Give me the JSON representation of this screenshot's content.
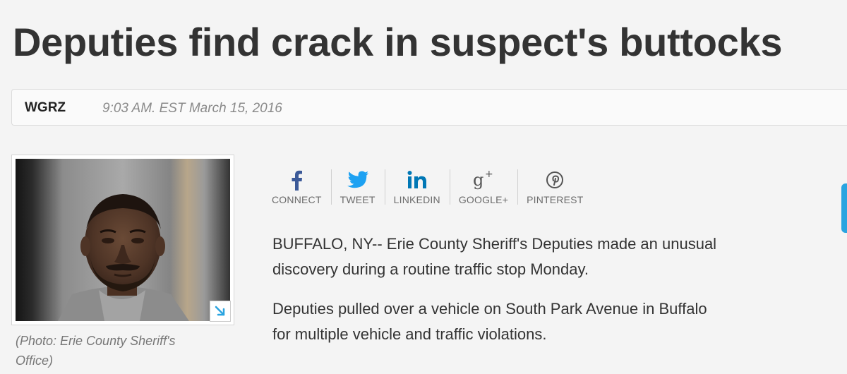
{
  "article": {
    "headline": "Deputies find crack in suspect's buttocks",
    "source": "WGRZ",
    "timestamp": "9:03 AM. EST March 15, 2016"
  },
  "photo": {
    "caption": "(Photo: Erie County Sheriff's Office)",
    "expand_icon": "expand-arrow-icon"
  },
  "share": {
    "items": [
      {
        "label": "CONNECT",
        "icon": "facebook-icon",
        "color": "#3b5998"
      },
      {
        "label": "TWEET",
        "icon": "twitter-icon",
        "color": "#1da1f2"
      },
      {
        "label": "LINKEDIN",
        "icon": "linkedin-icon",
        "color": "#0077b5"
      },
      {
        "label": "GOOGLE+",
        "icon": "google-plus-icon",
        "color": "#555555"
      },
      {
        "label": "PINTEREST",
        "icon": "pinterest-icon",
        "color": "#555555"
      }
    ]
  },
  "body": {
    "paragraphs": [
      "BUFFALO, NY-- Erie County Sheriff's Deputies made an unusual discovery during a routine traffic stop Monday.",
      "Deputies pulled over a vehicle on South Park Avenue in Buffalo for multiple vehicle and traffic violations."
    ]
  },
  "colors": {
    "accent": "#2aa4e0",
    "text": "#333333",
    "muted": "#8a8a8a"
  }
}
